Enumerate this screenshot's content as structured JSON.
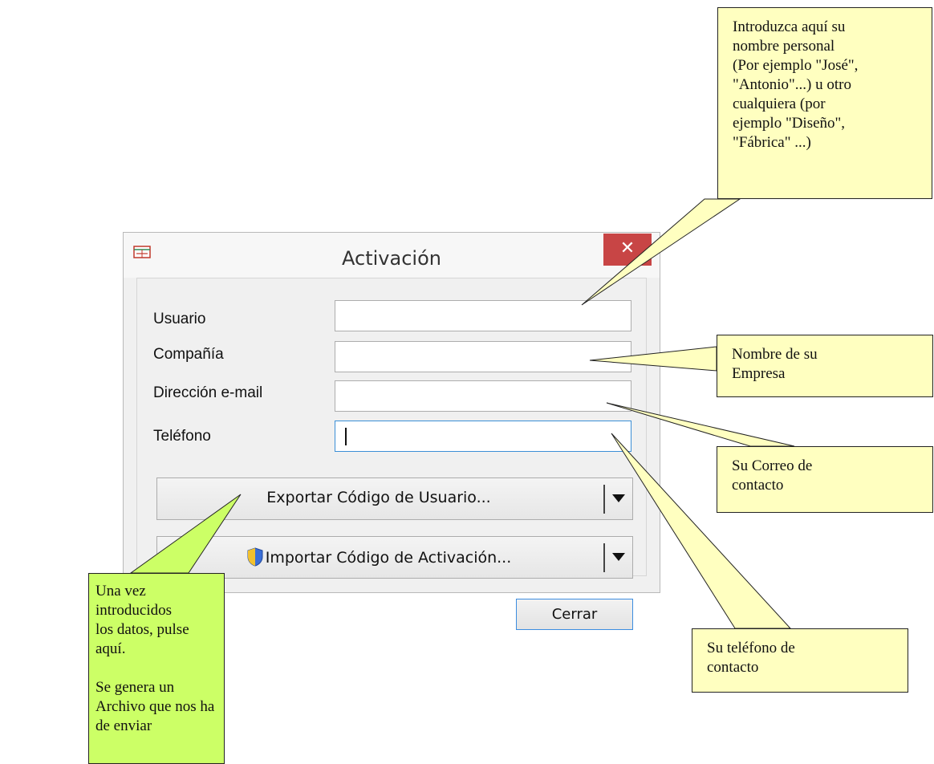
{
  "dialog": {
    "title": "Activación",
    "close_symbol": "✕",
    "fields": [
      {
        "label": "Usuario",
        "value": ""
      },
      {
        "label": "Compañía",
        "value": ""
      },
      {
        "label": "Dirección e-mail",
        "value": ""
      },
      {
        "label": "Teléfono",
        "value": ""
      }
    ],
    "export_button": "Exportar Código de Usuario...",
    "import_button": "Importar Código de Activación...",
    "close_button": "Cerrar",
    "icons": [
      "app-icon",
      "uac-shield-icon",
      "dropdown-arrow-icon",
      "close-icon"
    ]
  },
  "callouts": {
    "usuario": "Introduzca aquí su\nnombre personal\n(Por ejemplo \"José\",\n\"Antonio\"...) u otro\ncualquiera (por\nejemplo \"Diseño\",\n\"Fábrica\" ...)",
    "compania": "Nombre de su\nEmpresa",
    "email": "Su Correo de\ncontacto",
    "telefono": "Su teléfono de\ncontacto",
    "exportar": "Una vez introducidos\nlos datos, pulse  aquí.\n\nSe genera un\nArchivo que nos ha\nde enviar"
  },
  "colors": {
    "callout_yellow": "#ffffc0",
    "callout_green": "#ccff66",
    "close_red": "#c84545",
    "focus_blue": "#3b8fd6"
  }
}
